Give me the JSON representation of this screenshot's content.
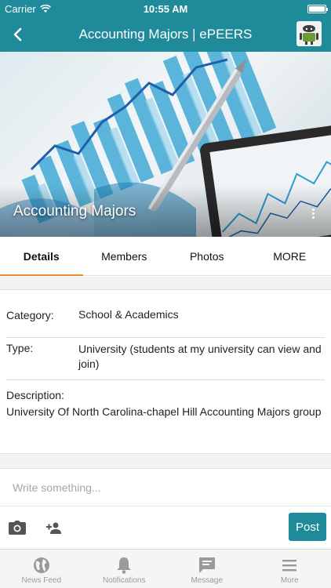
{
  "status_bar": {
    "carrier": "Carrier",
    "time": "10:55 AM"
  },
  "nav": {
    "title": "Accounting Majors | ePEERS",
    "back_icon": "chevron-left-icon",
    "avatar_icon": "android-avatar-icon"
  },
  "cover": {
    "title": "Accounting Majors",
    "more_icon": "more-vertical-icon"
  },
  "tabs": [
    {
      "label": "Details",
      "active": true
    },
    {
      "label": "Members",
      "active": false
    },
    {
      "label": "Photos",
      "active": false
    },
    {
      "label": "MORE",
      "active": false
    }
  ],
  "details": {
    "category_label": "Category:",
    "category_value": "School & Academics",
    "type_label": "Type:",
    "type_value": "University (students at my university can view and join)",
    "description_label": "Description:",
    "description_value": "University Of North Carolina-chapel Hill Accounting Majors group"
  },
  "composer": {
    "placeholder": "Write something...",
    "camera_icon": "camera-icon",
    "tag_icon": "add-person-icon",
    "post_label": "Post"
  },
  "bottom_nav": [
    {
      "label": "News Feed",
      "icon": "globe-icon"
    },
    {
      "label": "Notifications",
      "icon": "bell-icon"
    },
    {
      "label": "Message",
      "icon": "chat-icon"
    },
    {
      "label": "More",
      "icon": "menu-icon"
    }
  ],
  "colors": {
    "primary": "#1f8a9a",
    "tab_indicator": "#f28c28",
    "inactive": "#9a9a9a"
  }
}
